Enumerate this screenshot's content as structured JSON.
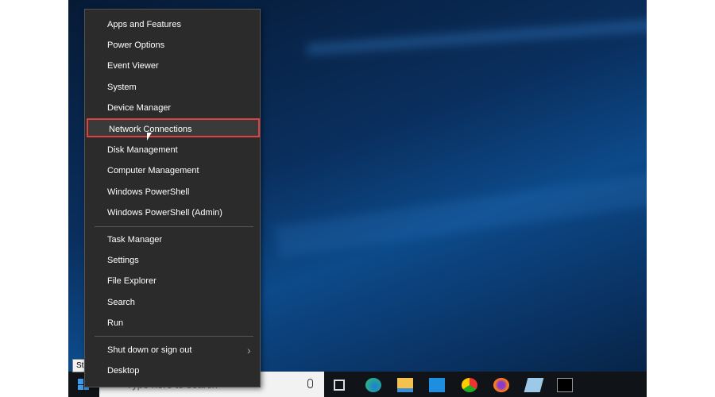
{
  "menu": {
    "items": [
      "Apps and Features",
      "Power Options",
      "Event Viewer",
      "System",
      "Device Manager",
      "Network Connections",
      "Disk Management",
      "Computer Management",
      "Windows PowerShell",
      "Windows PowerShell (Admin)",
      "Task Manager",
      "Settings",
      "File Explorer",
      "Search",
      "Run",
      "Shut down or sign out",
      "Desktop"
    ],
    "highlighted": "Network Connections"
  },
  "tooltip": "Start",
  "taskbar": {
    "search_placeholder": "Type here to search",
    "icons": [
      "windows-start-icon",
      "microphone-icon",
      "task-view-icon",
      "edge-icon",
      "file-explorer-icon",
      "mail-icon",
      "chrome-icon",
      "firefox-icon",
      "notepad-icon",
      "command-prompt-icon"
    ]
  },
  "colors": {
    "highlight_border": "#e04040",
    "menu_bg": "#2b2b2b"
  }
}
